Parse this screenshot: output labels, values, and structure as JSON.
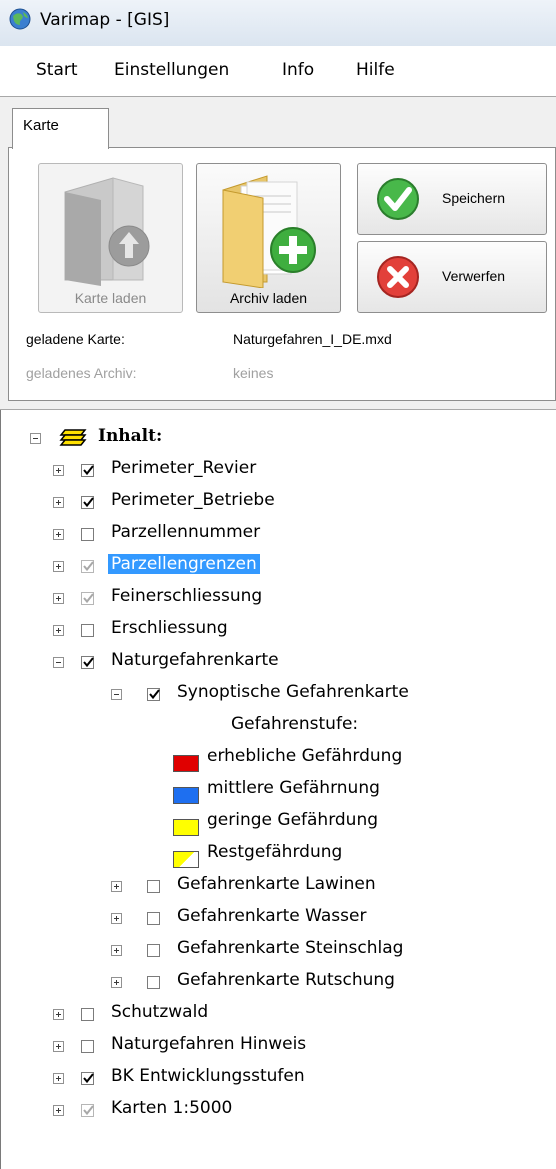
{
  "window": {
    "title": "Varimap - [GIS]",
    "icon": "globe-icon"
  },
  "menu": [
    "Start",
    "Einstellungen",
    "Info",
    "Hilfe"
  ],
  "ribbon": {
    "tab": "Karte",
    "buttons": {
      "karte_laden": "Karte laden",
      "archiv_laden": "Archiv laden",
      "speichern": "Speichern",
      "verwerfen": "Verwerfen"
    },
    "loaded_map_label": "geladene Karte:",
    "loaded_map_value": "Naturgefahren_I_DE.mxd",
    "loaded_archive_label": "geladenes Archiv:",
    "loaded_archive_value": "keines"
  },
  "tree": {
    "root_label": "Inhalt:",
    "layers": [
      {
        "label": "Perimeter_Revier",
        "checked": true
      },
      {
        "label": "Perimeter_Betriebe",
        "checked": true
      },
      {
        "label": "Parzellennummer",
        "checked": false
      },
      {
        "label": "Parzellengrenzen",
        "checked": true,
        "greyed": true,
        "selected": true
      },
      {
        "label": "Feinerschliessung",
        "checked": true,
        "greyed": true
      },
      {
        "label": "Erschliessung",
        "checked": false
      },
      {
        "label": "Naturgefahrenkarte",
        "checked": true,
        "expanded": true
      },
      {
        "label": "Synoptische Gefahrenkarte",
        "checked": true,
        "expanded": true
      },
      {
        "label": "Gefahrenkarte Lawinen",
        "checked": false
      },
      {
        "label": "Gefahrenkarte Wasser",
        "checked": false
      },
      {
        "label": "Gefahrenkarte Steinschlag",
        "checked": false
      },
      {
        "label": "Gefahrenkarte Rutschung",
        "checked": false
      },
      {
        "label": "Schutzwald",
        "checked": false
      },
      {
        "label": "Naturgefahren Hinweis",
        "checked": false
      },
      {
        "label": "BK Entwicklungsstufen",
        "checked": true
      },
      {
        "label": "Karten 1:5000",
        "checked": true,
        "greyed": true
      }
    ],
    "legend": {
      "heading": "Gefahrenstufe:",
      "items": [
        {
          "label": "erhebliche Gefährdung",
          "color": "#e00000"
        },
        {
          "label": "mittlere Gefährnung",
          "color": "#1e6ff0"
        },
        {
          "label": "geringe Gefährdung",
          "color": "#ffff00"
        },
        {
          "label": "Restgefährdung",
          "color": "#ffff00",
          "pattern": "hatched"
        }
      ]
    }
  }
}
